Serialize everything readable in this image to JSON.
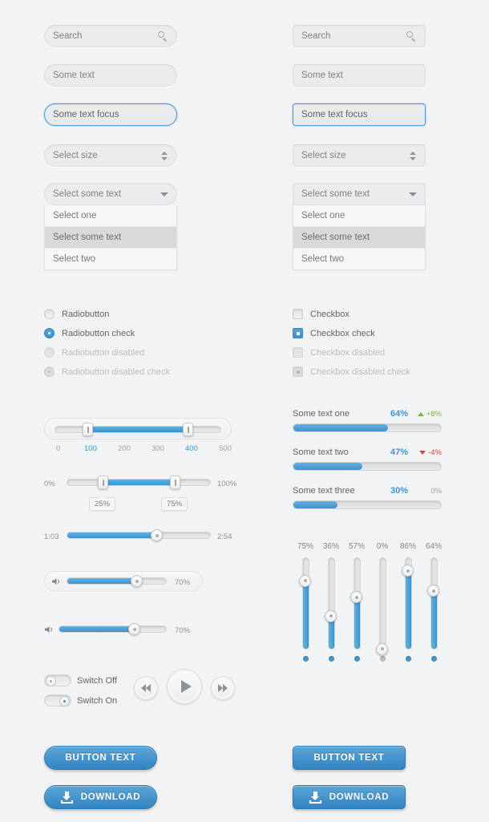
{
  "inputs": {
    "search": {
      "value": "Search",
      "icon": "search-icon"
    },
    "text": {
      "value": "Some text"
    },
    "focus": {
      "value": "Some text focus"
    },
    "size": {
      "value": "Select size",
      "icon": "spinner-updown-icon"
    }
  },
  "dropdown": {
    "selected": "Select some text",
    "options": [
      "Select one",
      "Select some text",
      "Select two"
    ],
    "highlighted_index": 1
  },
  "radios": [
    {
      "label": "Radiobutton",
      "checked": false,
      "disabled": false
    },
    {
      "label": "Radiobutton check",
      "checked": true,
      "disabled": false
    },
    {
      "label": "Radiobutton disabled",
      "checked": false,
      "disabled": true
    },
    {
      "label": "Radiobutton disabled check",
      "checked": true,
      "disabled": true
    }
  ],
  "checkboxes": [
    {
      "label": "Checkbox",
      "checked": false,
      "disabled": false
    },
    {
      "label": "Checkbox check",
      "checked": true,
      "disabled": false
    },
    {
      "label": "Checkbox disabled",
      "checked": false,
      "disabled": true
    },
    {
      "label": "Checkbox disabled check",
      "checked": true,
      "disabled": true
    }
  ],
  "range_slider": {
    "min": 0,
    "max": 500,
    "handle_low": 100,
    "handle_high": 400,
    "ticks": [
      "0",
      "100",
      "200",
      "300",
      "400",
      "500"
    ],
    "active_ticks": [
      1,
      4
    ]
  },
  "percent_slider": {
    "min_label": "0%",
    "max_label": "100%",
    "handle_low": 25,
    "handle_high": 75,
    "bubble_low": "25%",
    "bubble_high": "75%"
  },
  "time_slider": {
    "elapsed": "1:03",
    "total": "2:54",
    "percent": 62
  },
  "volume": [
    {
      "value": 70,
      "label": "70%",
      "icon": "volume-icon",
      "boxed": true
    },
    {
      "value": 70,
      "label": "70%",
      "icon": "volume-icon",
      "boxed": false
    }
  ],
  "switches": [
    {
      "label": "Switch Off",
      "on": false
    },
    {
      "label": "Switch On",
      "on": true
    }
  ],
  "media_buttons": [
    {
      "name": "previous-button",
      "icon": "rewind-icon"
    },
    {
      "name": "play-button",
      "icon": "play-icon"
    },
    {
      "name": "next-button",
      "icon": "fast-forward-icon"
    }
  ],
  "progress_rows": [
    {
      "label": "Some text one",
      "percent": "64%",
      "value": 64,
      "delta": "+8%",
      "direction": "up"
    },
    {
      "label": "Some text two",
      "percent": "47%",
      "value": 47,
      "delta": "-4%",
      "direction": "down"
    },
    {
      "label": "Some text three",
      "percent": "30%",
      "value": 30,
      "delta": "0%",
      "direction": "none"
    }
  ],
  "vertical_sliders": [
    {
      "label": "75%",
      "value": 75
    },
    {
      "label": "36%",
      "value": 36
    },
    {
      "label": "57%",
      "value": 57
    },
    {
      "label": "0%",
      "value": 0
    },
    {
      "label": "86%",
      "value": 86
    },
    {
      "label": "64%",
      "value": 64
    }
  ],
  "buttons": {
    "primary": "BUTTON TEXT",
    "download": "DOWNLOAD",
    "download_icon": "download-icon"
  },
  "colors": {
    "accent": "#3f93cf",
    "accent_light": "#63b0e2",
    "button": "#3484c2",
    "up": "#7cb342",
    "down": "#d1453e",
    "background": "#f2f3f4"
  }
}
